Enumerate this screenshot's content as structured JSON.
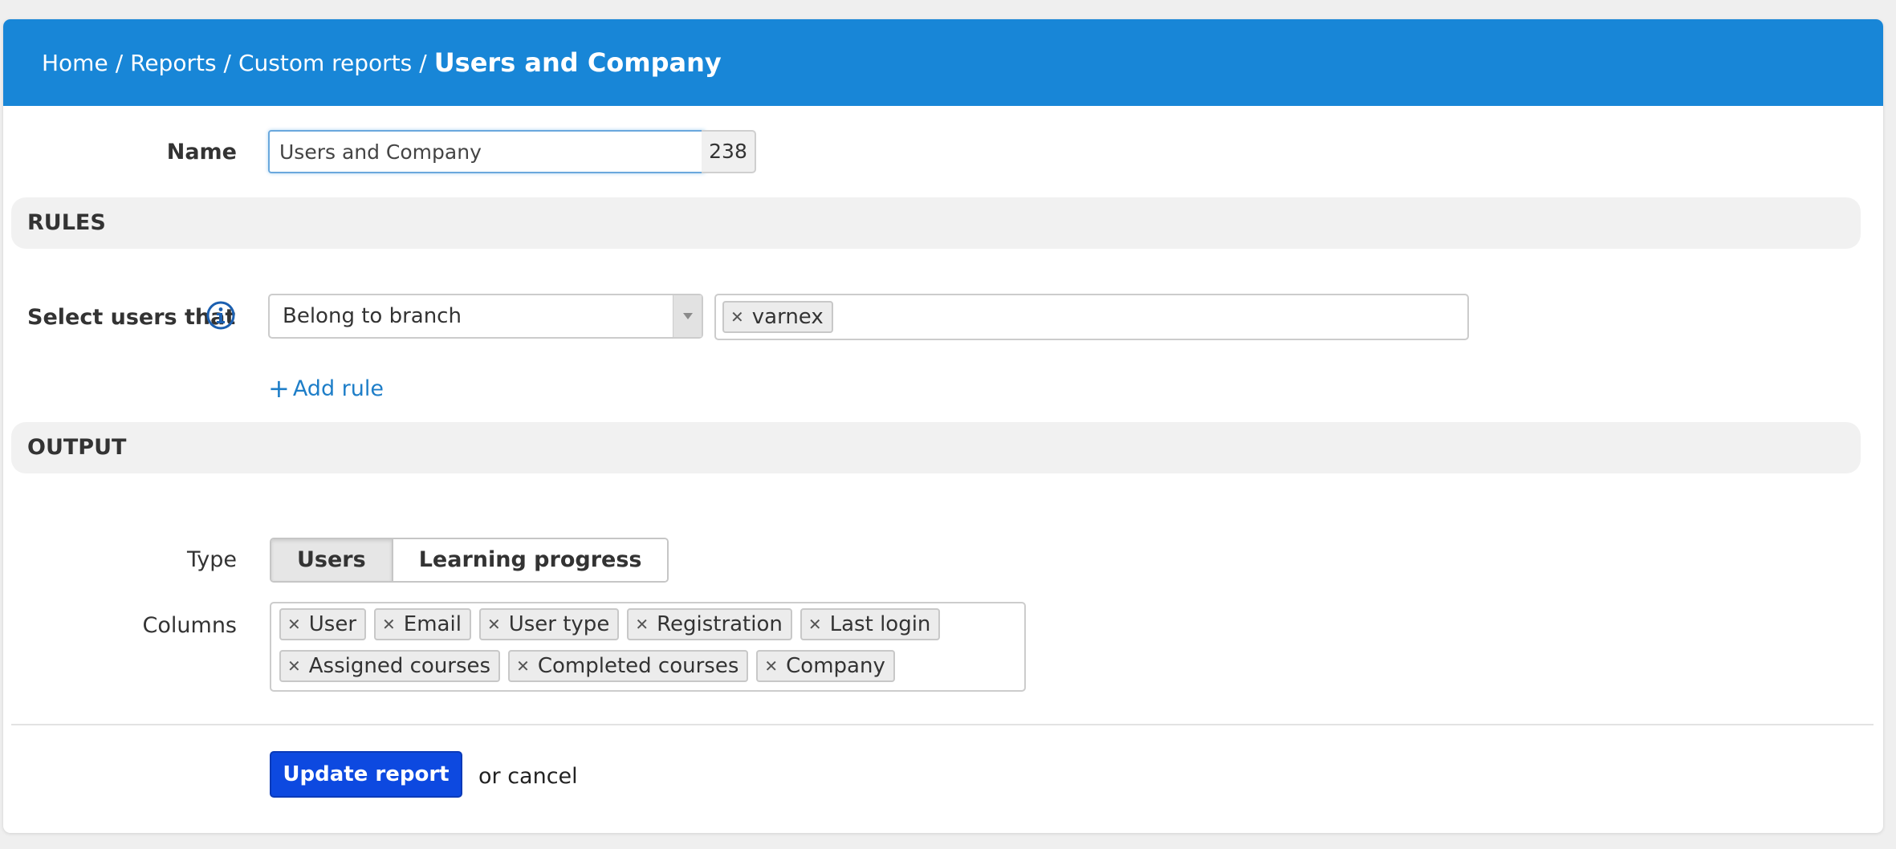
{
  "breadcrumb": {
    "items": [
      "Home",
      "Reports",
      "Custom reports"
    ],
    "separator": "/",
    "current": "Users and Company"
  },
  "form": {
    "name_label": "Name",
    "name_value": "Users and Company",
    "name_char_count": "238"
  },
  "rules": {
    "section_title": "RULES",
    "select_users_label": "Select users that",
    "rule_type": "Belong to branch",
    "rule_values": [
      "varnex"
    ],
    "add_rule_label": "Add rule"
  },
  "output": {
    "section_title": "OUTPUT",
    "type_label": "Type",
    "type_options": [
      "Users",
      "Learning progress"
    ],
    "type_selected": "Users",
    "columns_label": "Columns",
    "columns": [
      "User",
      "Email",
      "User type",
      "Registration",
      "Last login",
      "Assigned courses",
      "Completed courses",
      "Company"
    ]
  },
  "actions": {
    "update_label": "Update report",
    "cancel_label": "or cancel"
  },
  "colors": {
    "header_bg": "#1886d7",
    "primary_button": "#0d49e0",
    "link": "#1e7ec8",
    "info_icon": "#1b5fb0"
  },
  "icons": {
    "info": "info-circle-icon",
    "dropdown": "caret-down-icon",
    "remove_tag": "close-x-icon",
    "add": "plus-icon"
  }
}
